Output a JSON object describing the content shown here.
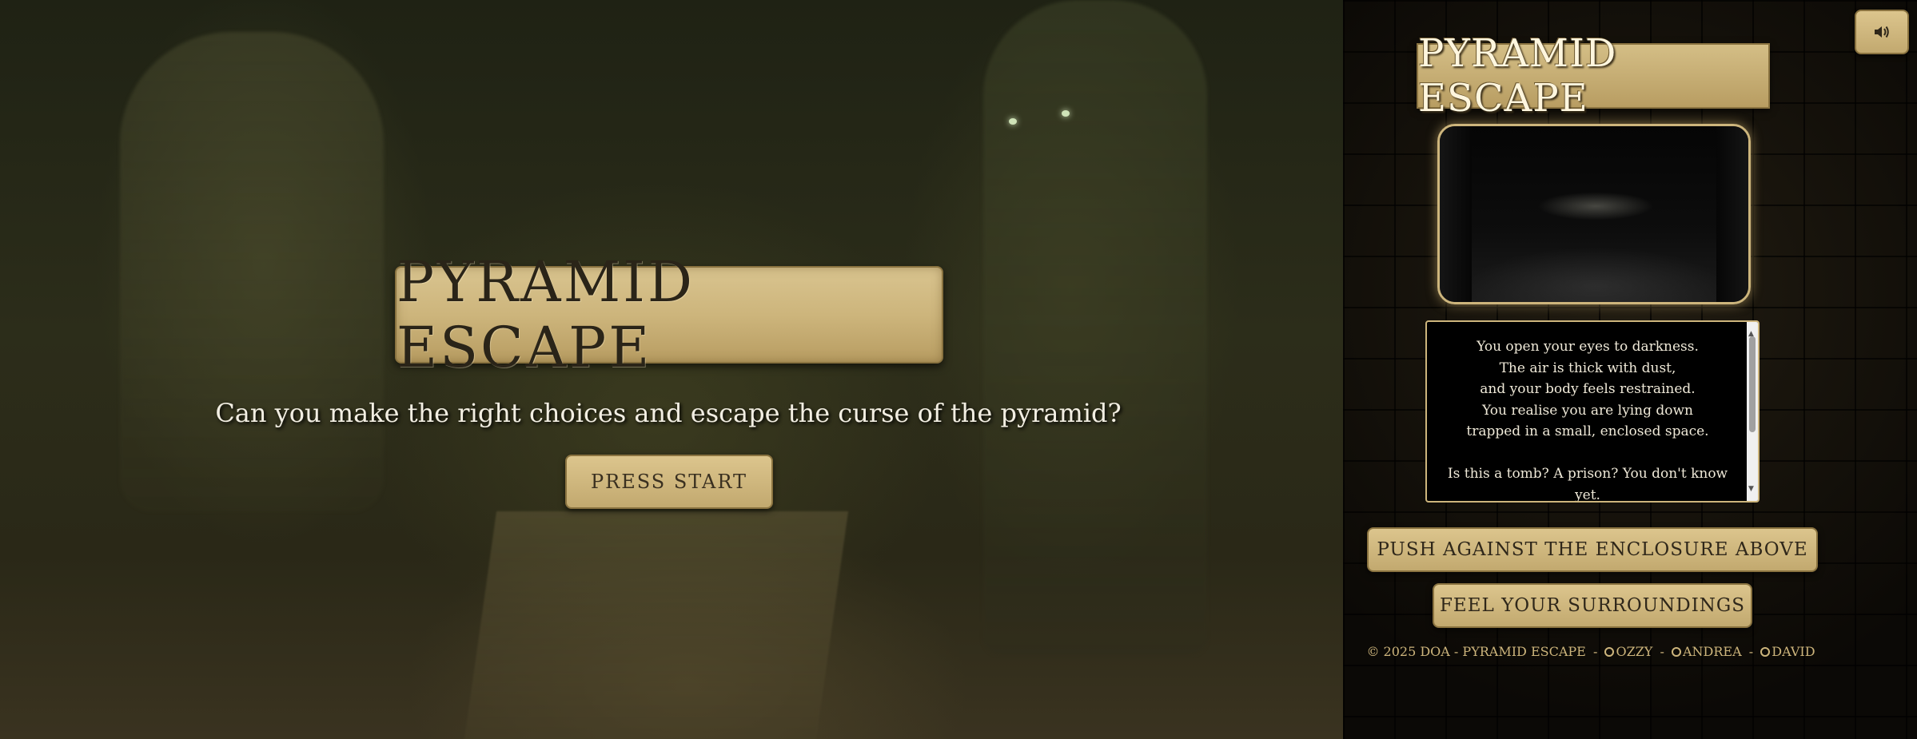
{
  "scene": {
    "title": "PYRAMID ESCAPE",
    "tagline": "Can you make the right choices and escape the curse of the pyramid?",
    "start_label": "PRESS START"
  },
  "panel": {
    "title": "PYRAMID ESCAPE",
    "sound_icon": "speaker-icon",
    "narrative": [
      "You open your eyes to darkness.",
      "The air is thick with dust,",
      "and your body feels restrained.",
      "You realise you are lying down",
      "trapped in a small, enclosed space.",
      "",
      "Is this a tomb? A prison? You don't know yet."
    ],
    "choices": [
      "PUSH AGAINST THE ENCLOSURE ABOVE",
      "FEEL YOUR SURROUNDINGS"
    ]
  },
  "footer": {
    "copyright": "© 2025 DOA - PYRAMID ESCAPE",
    "sep": "-",
    "authors": [
      "OZZY",
      "ANDREA",
      "DAVID"
    ]
  },
  "colors": {
    "gold": "#cdb57c",
    "plaque": "#d9c48f",
    "text_dark": "#2a2418"
  }
}
